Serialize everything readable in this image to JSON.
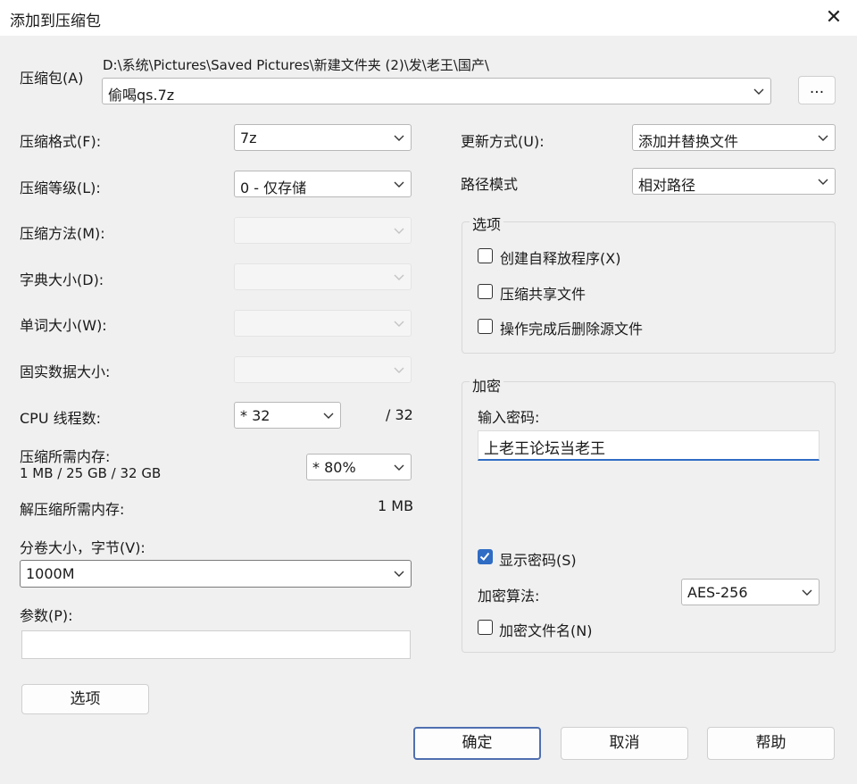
{
  "window": {
    "title": "添加到压缩包",
    "close_glyph": "✕"
  },
  "archive": {
    "label": "压缩包(A)",
    "path": "D:\\系统\\Pictures\\Saved Pictures\\新建文件夹 (2)\\发\\老王\\国产\\",
    "filename": "偷喝qs.7z",
    "browse_label": "..."
  },
  "left": {
    "format_label": "压缩格式(F):",
    "format_value": "7z",
    "level_label": "压缩等级(L):",
    "level_value": "0 - 仅存储",
    "method_label": "压缩方法(M):",
    "dict_label": "字典大小(D):",
    "word_label": "单词大小(W):",
    "solid_label": "固实数据大小:",
    "cpu_label": "CPU 线程数:",
    "cpu_value": "* 32",
    "cpu_max": "/ 32",
    "mem_compress_label": "压缩所需内存:",
    "mem_compress_detail": "1 MB / 25 GB / 32 GB",
    "mem_percent": "* 80%",
    "mem_decompress_label": "解压缩所需内存:",
    "mem_decompress_value": "1 MB",
    "split_label": "分卷大小，字节(V):",
    "split_value": "1000M",
    "params_label": "参数(P):",
    "params_value": "",
    "options_button": "选项"
  },
  "right": {
    "update_label": "更新方式(U):",
    "update_value": "添加并替换文件",
    "path_label": "路径模式",
    "path_value": "相对路径",
    "options_group": {
      "title": "选项",
      "items": [
        {
          "label": "创建自释放程序(X)",
          "checked": false
        },
        {
          "label": "压缩共享文件",
          "checked": false
        },
        {
          "label": "操作完成后删除源文件",
          "checked": false
        }
      ]
    },
    "encryption": {
      "title": "加密",
      "password_label": "输入密码:",
      "password_value": "上老王论坛当老王",
      "show_password_label": "显示密码(S)",
      "show_password_checked": true,
      "method_label": "加密算法:",
      "method_value": "AES-256",
      "encrypt_names_label": "加密文件名(N)",
      "encrypt_names_checked": false
    }
  },
  "buttons": {
    "ok": "确定",
    "cancel": "取消",
    "help": "帮助"
  },
  "colors": {
    "accent": "#2f6cc4",
    "default_border": "#4f6fb0"
  }
}
